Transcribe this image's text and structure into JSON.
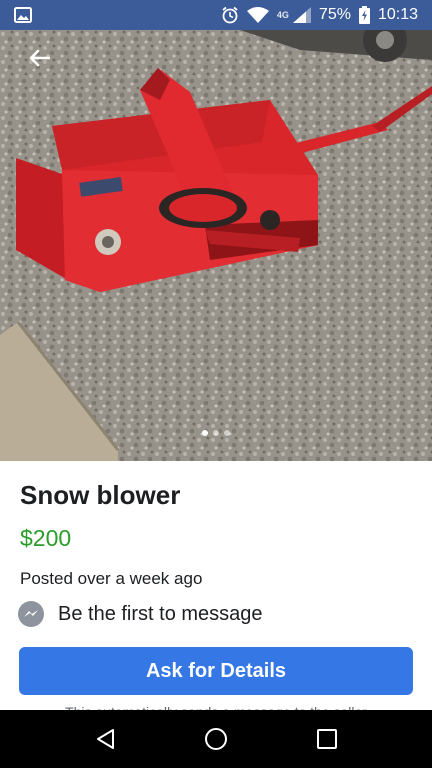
{
  "status_bar": {
    "network": "4G",
    "battery": "75%",
    "time": "10:13",
    "icons": [
      "gallery-icon",
      "alarm-icon",
      "wifi-icon",
      "signal-icon",
      "battery-icon"
    ]
  },
  "listing": {
    "title": "Snow blower",
    "price": "$200",
    "posted": "Posted over a week ago",
    "message_prompt": "Be the first to message",
    "cta_label": "Ask for Details",
    "note": "This automatically sends a message to the seller"
  },
  "carousel": {
    "total": 3,
    "active": 1
  },
  "colors": {
    "status_bar": "#3b5b99",
    "price": "#2a9d2a",
    "cta": "#3578e5",
    "snowblower": "#d8262b"
  }
}
